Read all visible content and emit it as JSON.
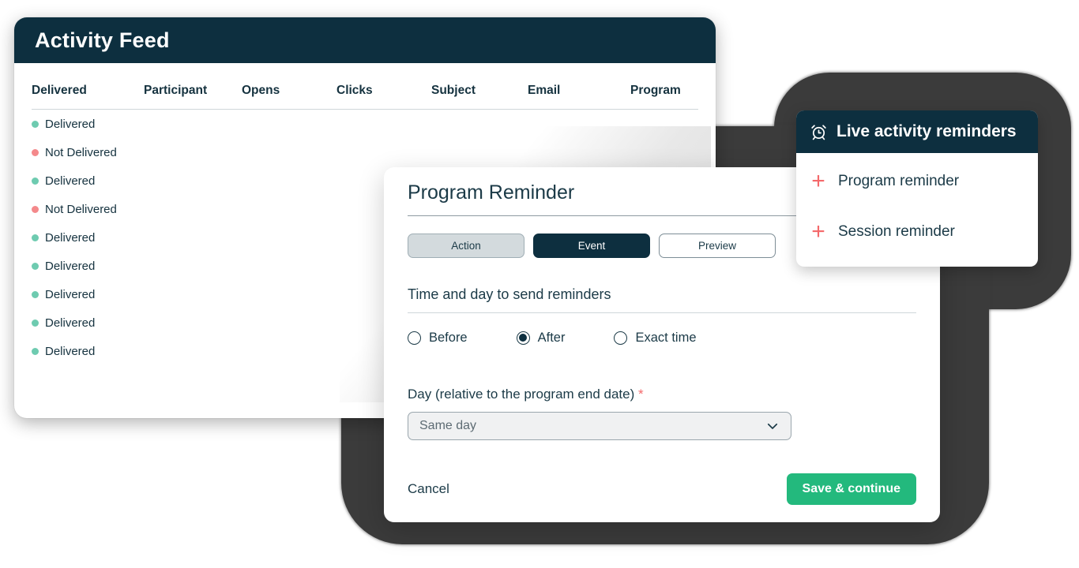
{
  "activity_feed": {
    "title": "Activity Feed",
    "columns": [
      "Delivered",
      "Participant",
      "Opens",
      "Clicks",
      "Subject",
      "Email",
      "Program"
    ],
    "rows": [
      {
        "status": "Delivered",
        "state": "ok"
      },
      {
        "status": "Not Delivered",
        "state": "bad"
      },
      {
        "status": "Delivered",
        "state": "ok"
      },
      {
        "status": "Not Delivered",
        "state": "bad"
      },
      {
        "status": "Delivered",
        "state": "ok"
      },
      {
        "status": "Delivered",
        "state": "ok"
      },
      {
        "status": "Delivered",
        "state": "ok"
      },
      {
        "status": "Delivered",
        "state": "ok"
      },
      {
        "status": "Delivered",
        "state": "ok"
      }
    ]
  },
  "modal": {
    "title": "Program Reminder",
    "tabs": [
      {
        "label": "Action",
        "style": "muted"
      },
      {
        "label": "Event",
        "style": "active"
      },
      {
        "label": "Preview",
        "style": "plain"
      }
    ],
    "section_label": "Time and day to send reminders",
    "radios": [
      {
        "label": "Before",
        "checked": false
      },
      {
        "label": "After",
        "checked": true
      },
      {
        "label": "Exact time",
        "checked": false
      }
    ],
    "field_label": "Day (relative to the program end date)",
    "required_marker": "*",
    "select_value": "Same day",
    "cancel_label": "Cancel",
    "save_label": "Save & continue"
  },
  "reminders_panel": {
    "title": "Live activity reminders",
    "icon": "alarm-clock-icon",
    "items": [
      {
        "label": "Program reminder",
        "icon": "plus-icon"
      },
      {
        "label": "Session reminder",
        "icon": "plus-icon"
      }
    ]
  },
  "colors": {
    "navy": "#0d2f3f",
    "green": "#23b97d",
    "red": "#f4696b",
    "dot_ok": "#6ecbb0",
    "dot_bad": "#f4898b",
    "blob": "#3b3b3b"
  }
}
